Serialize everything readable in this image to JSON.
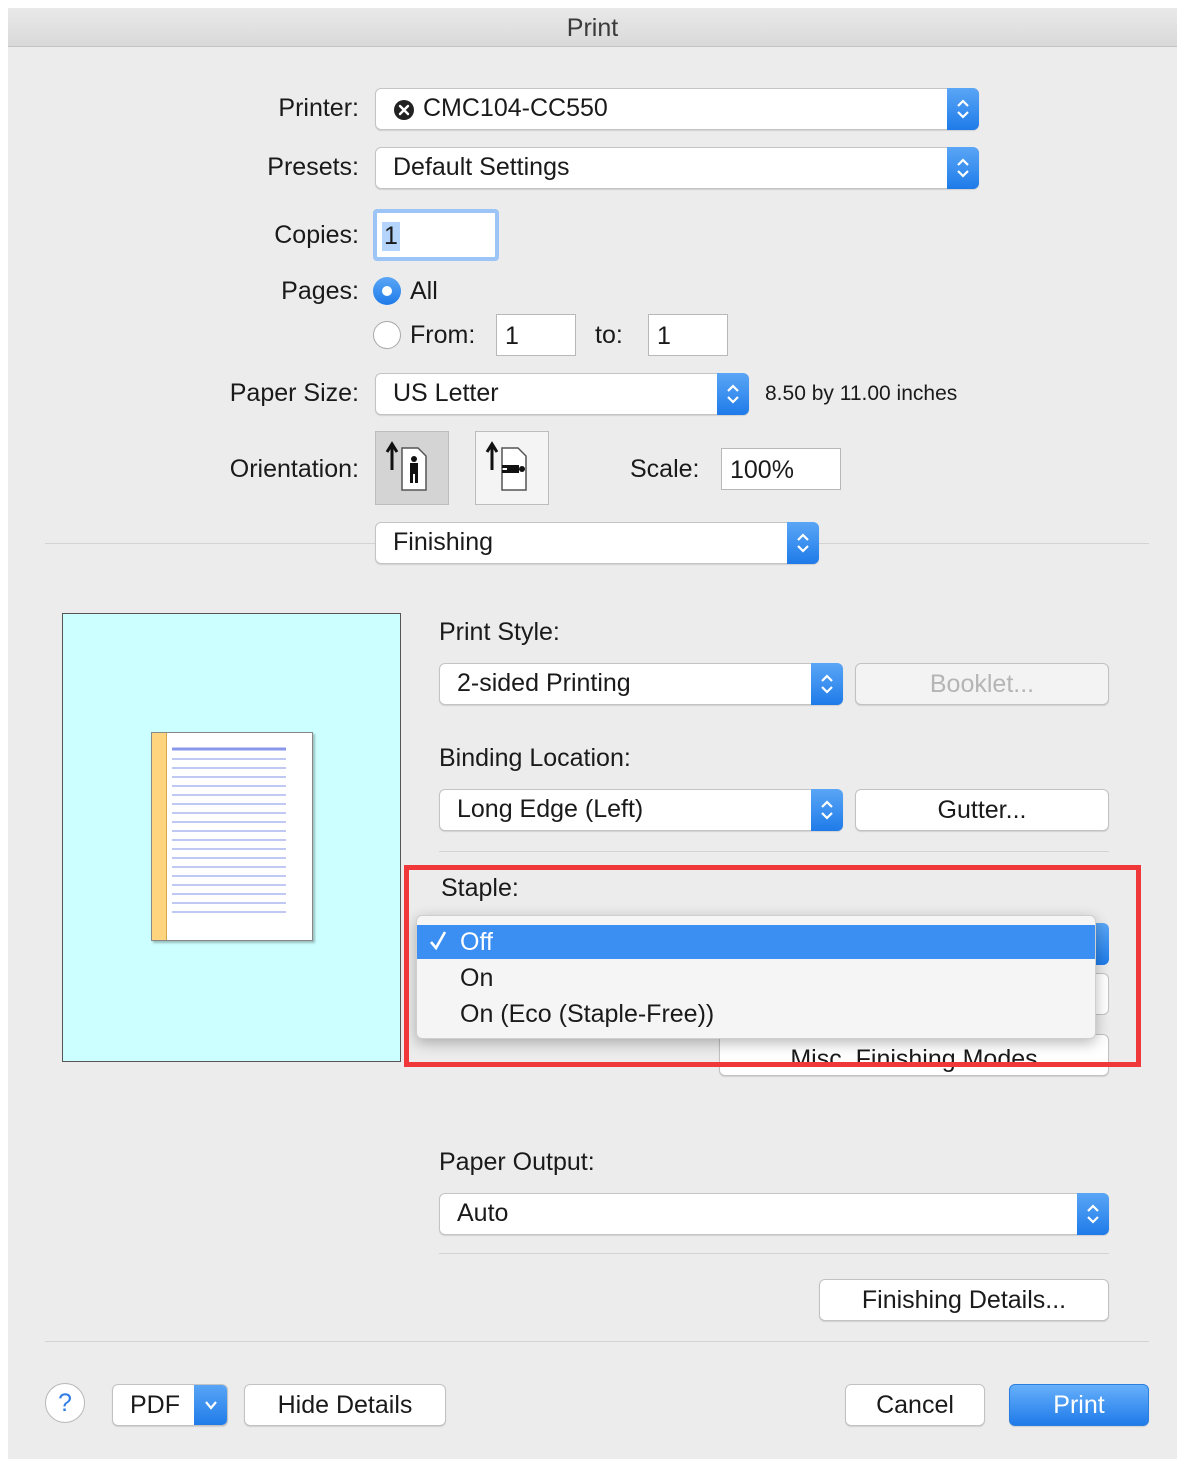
{
  "window": {
    "title": "Print"
  },
  "printer": {
    "label": "Printer:",
    "value": "CMC104-CC550"
  },
  "presets": {
    "label": "Presets:",
    "value": "Default Settings"
  },
  "copies": {
    "label": "Copies:",
    "value": "1"
  },
  "pages": {
    "label": "Pages:",
    "all_label": "All",
    "from_label": "From:",
    "from_value": "1",
    "to_label": "to:",
    "to_value": "1",
    "selected": "All"
  },
  "paper_size": {
    "label": "Paper Size:",
    "value": "US Letter",
    "dimensions": "8.50 by 11.00 inches"
  },
  "orientation": {
    "label": "Orientation:",
    "selected": "portrait"
  },
  "scale": {
    "label": "Scale:",
    "value": "100%"
  },
  "panel_selector": {
    "value": "Finishing"
  },
  "print_style": {
    "label": "Print Style:",
    "value": "2-sided Printing",
    "booklet_button": "Booklet..."
  },
  "binding_location": {
    "label": "Binding Location:",
    "value": "Long Edge (Left)",
    "gutter_button": "Gutter..."
  },
  "staple": {
    "label": "Staple:",
    "options": [
      "Off",
      "On",
      "On (Eco (Staple-Free))"
    ],
    "selected": "Off"
  },
  "misc_button": "Misc. Finishing Modes",
  "paper_output": {
    "label": "Paper Output:",
    "value": "Auto"
  },
  "finishing_details_button": "Finishing Details...",
  "footer": {
    "help": "?",
    "pdf": "PDF",
    "hide_details": "Hide Details",
    "cancel": "Cancel",
    "print": "Print"
  },
  "colors": {
    "accent": "#1f7be9",
    "highlight": "#f0383b",
    "preview_bg": "#ccffff",
    "binding": "#ffd47f"
  }
}
